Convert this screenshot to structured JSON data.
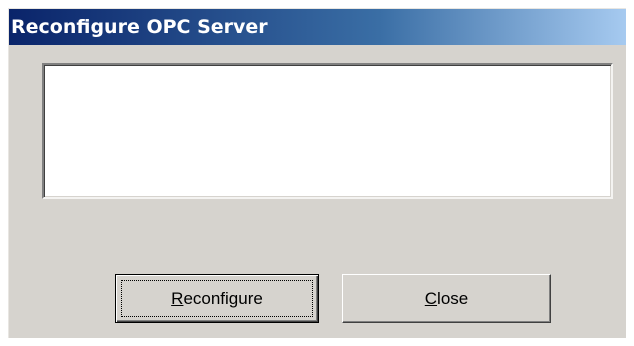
{
  "window": {
    "title": "Reconfigure OPC Server"
  },
  "status_box": {
    "content": ""
  },
  "buttons": {
    "reconfigure": {
      "mnemonic": "R",
      "rest": "econfigure",
      "is_default": true
    },
    "close": {
      "mnemonic": "C",
      "rest": "lose",
      "is_default": false
    }
  },
  "colors": {
    "title_bar_start": "#0a246a",
    "title_bar_end": "#a6caf0",
    "dialog_face": "#d6d3ce",
    "status_box_bg": "#ffffff"
  }
}
